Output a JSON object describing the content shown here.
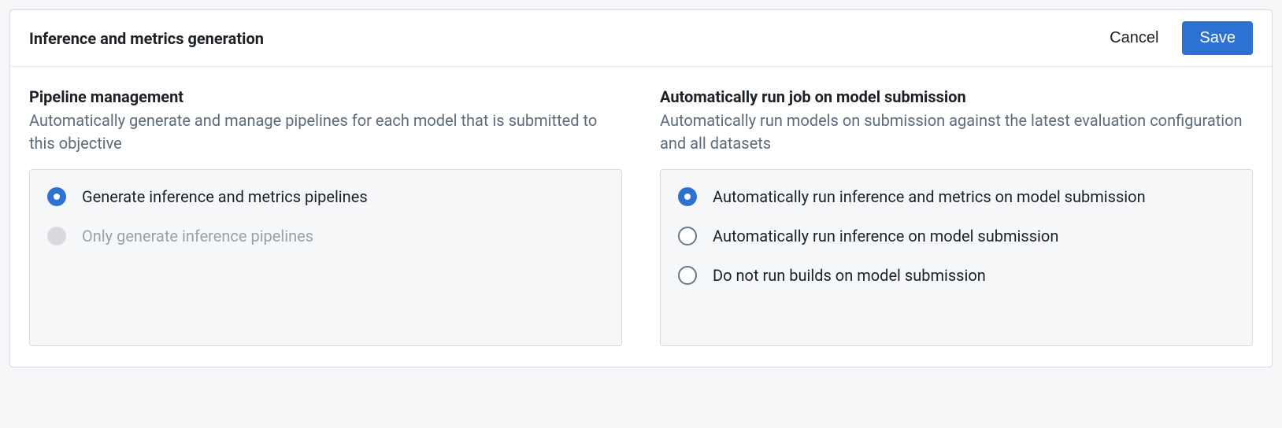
{
  "header": {
    "title": "Inference and metrics generation",
    "cancel_label": "Cancel",
    "save_label": "Save"
  },
  "sections": {
    "pipeline": {
      "title": "Pipeline management",
      "description": "Automatically generate and manage pipelines for each model that is submitted to this objective",
      "options": [
        {
          "label": "Generate inference and metrics pipelines",
          "selected": true,
          "disabled": false
        },
        {
          "label": "Only generate inference pipelines",
          "selected": false,
          "disabled": true
        }
      ]
    },
    "autorun": {
      "title": "Automatically run job on model submission",
      "description": "Automatically run models on submission against the latest evaluation configuration and all datasets",
      "options": [
        {
          "label": "Automatically run inference and metrics on model submission",
          "selected": true,
          "disabled": false
        },
        {
          "label": "Automatically run inference on model submission",
          "selected": false,
          "disabled": false
        },
        {
          "label": "Do not run builds on model submission",
          "selected": false,
          "disabled": false
        }
      ]
    }
  }
}
